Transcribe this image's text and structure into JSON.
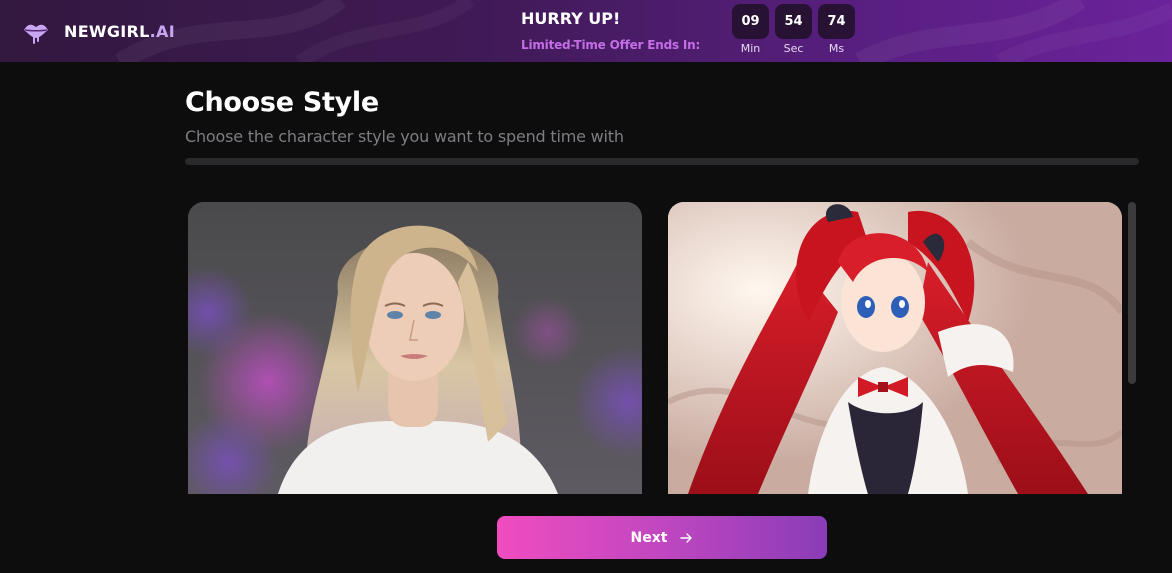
{
  "header": {
    "brand_name": "NEWGIRL",
    "brand_suffix": ".AI",
    "promo_title": "HURRY UP!",
    "promo_subtitle": "Limited-Time Offer Ends In:",
    "timer": [
      {
        "value": "09",
        "label": "Min"
      },
      {
        "value": "54",
        "label": "Sec"
      },
      {
        "value": "74",
        "label": "Ms"
      }
    ],
    "logo_icon": "lips-icon",
    "accent_color": "#c46ee6"
  },
  "main": {
    "title": "Choose Style",
    "subtitle": "Choose the character style you want to spend time with",
    "progress": 0,
    "styles": [
      {
        "image": "realistic-blonde-woman-portrait"
      },
      {
        "image": "anime-red-hair-girl-illustration"
      }
    ]
  },
  "footer": {
    "next_label": "Next",
    "next_icon": "arrow-right-icon",
    "button_gradient": [
      "#f04cbf",
      "#8a3cb8"
    ]
  }
}
